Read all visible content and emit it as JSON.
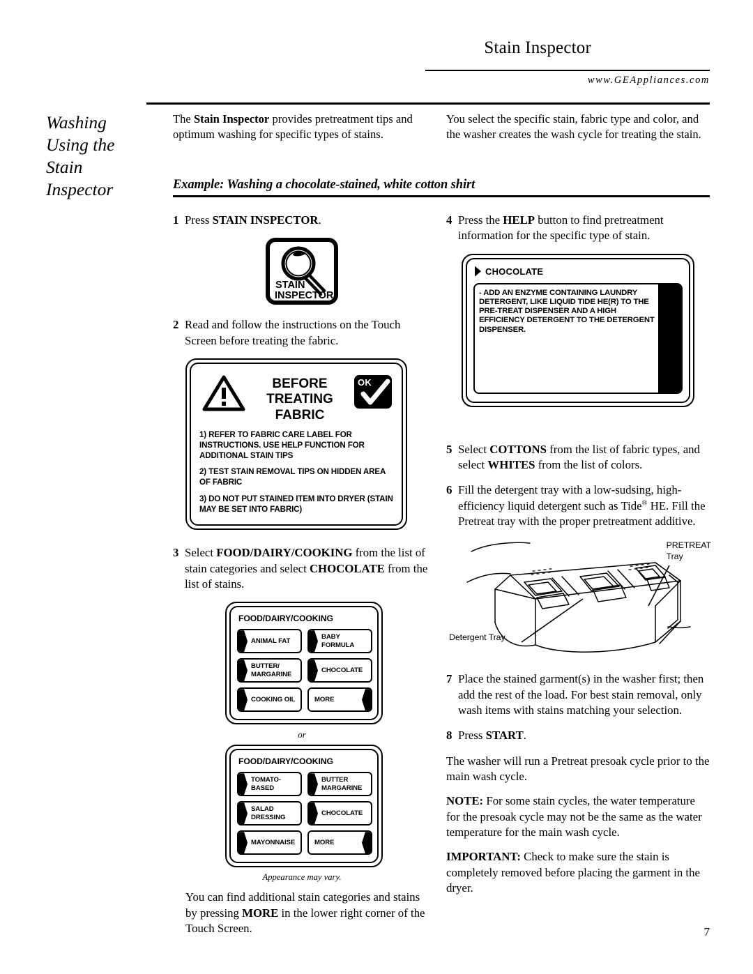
{
  "header": {
    "title": "Stain Inspector",
    "url": "www.GEAppliances.com"
  },
  "side_title": {
    "line1": "Washing",
    "line2": "Using the",
    "line3": "Stain",
    "line4": "Inspector"
  },
  "intro": {
    "left": "The Stain Inspector provides pretreatment tips and optimum washing for specific types of stains.",
    "left_bold": "Stain Inspector",
    "right": "You select the specific stain, fabric type and color, and the washer creates the wash cycle for treating the stain."
  },
  "example_heading": "Example: Washing a chocolate-stained, white cotton shirt",
  "steps": {
    "s1": {
      "num": "1",
      "text": "Press STAIN INSPECTOR.",
      "bold": "STAIN INSPECTOR"
    },
    "s2": {
      "num": "2",
      "text": "Read and follow the instructions on the Touch Screen before treating the fabric."
    },
    "s3": {
      "num": "3",
      "text": "Select FOOD/DAIRY/COOKING from the list of stain categories and select CHOCOLATE from the list of stains."
    },
    "s4": {
      "num": "4",
      "text": "Press the HELP button to find pretreatment information for the specific type of stain."
    },
    "s5": {
      "num": "5",
      "text": "Select COTTONS from the list of fabric types, and select WHITES from the list of colors."
    },
    "s6": {
      "num": "6",
      "text": "Fill the detergent tray with a low-sudsing, high-efficiency liquid detergent such as Tide® HE. Fill the Pretreat tray with the proper pretreatment additive."
    },
    "s7": {
      "num": "7",
      "text": "Place the stained garment(s) in the washer first; then add the rest of the load. For best stain removal, only wash items with stains matching your selection."
    },
    "s8": {
      "num": "8",
      "text": "Press START.",
      "bold": "START"
    }
  },
  "stain_inspector_icon": {
    "label_line1": "STAIN",
    "label_line2": "INSPECTOR"
  },
  "before_treating_panel": {
    "title_line1": "BEFORE",
    "title_line2": "TREATING",
    "title_line3": "FABRIC",
    "ok_label": "OK",
    "items": [
      "1) REFER TO FABRIC CARE LABEL FOR INSTRUCTIONS. USE HELP FUNCTION FOR ADDITIONAL STAIN TIPS",
      "2) TEST STAIN REMOVAL TIPS ON HIDDEN AREA OF FABRIC",
      "3) DO NOT PUT STAINED ITEM INTO DRYER (STAIN MAY BE SET INTO FABRIC)"
    ]
  },
  "menu_screen_1": {
    "title": "FOOD/DAIRY/COOKING",
    "buttons": [
      {
        "label": "ANIMAL FAT",
        "arrow": "left"
      },
      {
        "label": "BABY FORMULA",
        "arrow": "left"
      },
      {
        "label": "BUTTER/\nMARGARINE",
        "arrow": "left"
      },
      {
        "label": "CHOCOLATE",
        "arrow": "left"
      },
      {
        "label": "COOKING OIL",
        "arrow": "left"
      },
      {
        "label": "MORE",
        "arrow": "right"
      }
    ]
  },
  "or_separator": "or",
  "menu_screen_2": {
    "title": "FOOD/DAIRY/COOKING",
    "buttons": [
      {
        "label": "TOMATO-BASED",
        "arrow": "left"
      },
      {
        "label": "BUTTER\nMARGARINE",
        "arrow": "left"
      },
      {
        "label": "SALAD\nDRESSING",
        "arrow": "left"
      },
      {
        "label": "CHOCOLATE",
        "arrow": "left"
      },
      {
        "label": "MAYONNAISE",
        "arrow": "left"
      },
      {
        "label": "MORE",
        "arrow": "right"
      }
    ]
  },
  "appearance_caption": "Appearance may vary.",
  "more_note": "You can find additional stain categories and stains by pressing MORE in the lower right corner of the Touch Screen.",
  "help_screen": {
    "title": "CHOCOLATE",
    "body": "- ADD AN ENZYME CONTAINING LAUNDRY DETERGENT, LIKE LIQUID TIDE HE(R) TO THE PRE-TREAT DISPENSER AND A HIGH EFFICIENCY DETERGENT TO THE DETERGENT DISPENSER."
  },
  "tray_figure": {
    "pretreat_label_line1": "PRETREAT",
    "pretreat_label_line2": "Tray",
    "detergent_label": "Detergent Tray"
  },
  "closing": {
    "presoak": "The washer will run a Pretreat presoak cycle prior to the main wash cycle.",
    "note_label": "NOTE:",
    "note": "For some stain cycles, the water temperature for the presoak cycle may not be the same as the water temperature for the main wash cycle.",
    "important_label": "IMPORTANT:",
    "important": "Check to make sure the stain is completely removed before placing the garment in the dryer."
  },
  "page_number": "7"
}
